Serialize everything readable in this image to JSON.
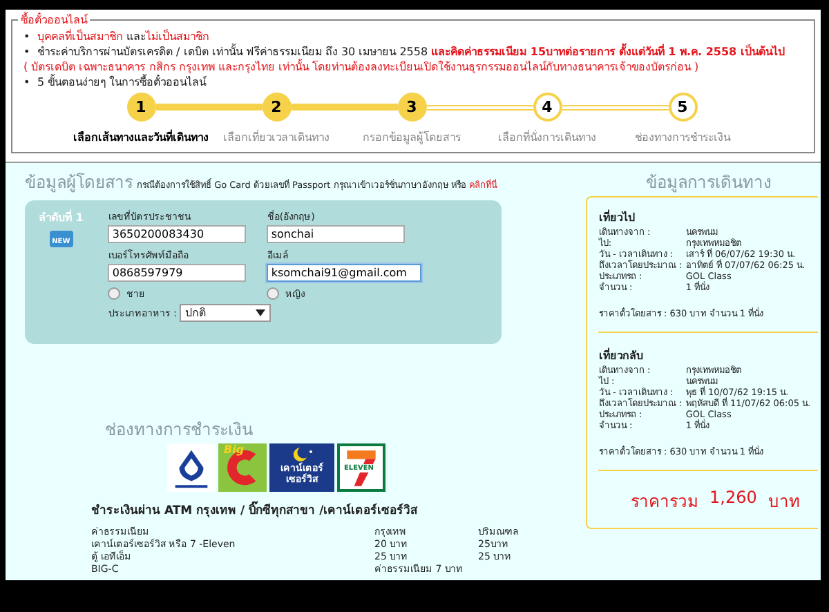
{
  "notice": {
    "legend": "ซื้อตั๋วออนไลน์",
    "bullets": [
      {
        "marker": "•",
        "parts": [
          {
            "text": "บุคคลที่เป็นสมาชิก",
            "emphasis": true
          },
          {
            "text": " และ",
            "emphasis": false
          },
          {
            "text": "ไม่เป็นสมาชิก",
            "emphasis": true
          }
        ]
      },
      {
        "marker": "•",
        "parts": [
          {
            "text": "ชำระค่าบริการผ่านบัตรเครดิต / เดบิต เท่านั้น ฟรีค่าธรรมเนียม ถึง 30 เมษายน 2558 ",
            "emphasis": false
          },
          {
            "text": "**และคิดค่าธรรมเนียม 15บาทต่อรายการ ตั้งแต่วันที่ 1 พ.ค. 2558 เป็นต้นไป**",
            "emphasis": true
          }
        ],
        "note": "( บัตรเดบิต เฉพาะธนาคาร กสิกร กรุงเทพ และกรุงไทย เท่านั้น โดยท่านต้องลงทะเบียนเปิดใช้งานธุรกรรมออนไลน์กับทางธนาคารเจ้าของบัตรก่อน )"
      },
      {
        "marker": "•",
        "parts": [
          {
            "text": "5 ขั้นตอนง่ายๆ ในการซื้อตั๋วออนไลน์",
            "emphasis": false
          }
        ]
      }
    ]
  },
  "steps": [
    {
      "number": "1",
      "label": "เลือกเส้นทางและวันที่เดินทาง",
      "done": true,
      "selected": true
    },
    {
      "number": "2",
      "label": "เลือกเที่ยวเวลาเดินทาง",
      "done": true,
      "selected": false
    },
    {
      "number": "3",
      "label": "กรอกข้อมูลผู้โดยสาร",
      "done": true,
      "selected": false
    },
    {
      "number": "4",
      "label": "เลือกที่นั่งการเดินทาง",
      "done": false,
      "selected": false
    },
    {
      "number": "5",
      "label": "ช่องทางการชำระเงิน",
      "done": false,
      "selected": false
    }
  ],
  "passenger": {
    "title": "ข้อมูลผู้โดยสาร",
    "note": "กรณีต้องการใช้สิทธิ์ Go Card ด้วยเลขที่ Passport กรุณาเข้าเวอร์ชั่นภาษาอังกฤษ หรือ ",
    "link": "คลิกที่นี่",
    "seat_label": "ลำดับที่ 1",
    "badge": "NEW",
    "fields": [
      {
        "label": "เลขที่บัตรประชาชน",
        "value": "3650200083430",
        "focused": false
      },
      {
        "label": "ชื่อ(อังกฤษ)",
        "value": "sonchai",
        "focused": false
      },
      {
        "label": "เบอร์โทรศัพท์มือถือ",
        "value": "0868597979",
        "focused": false
      },
      {
        "label": "อีเมล์",
        "value": "ksomchai91@gmail.com",
        "focused": true
      }
    ],
    "genders": [
      {
        "label": "ชาย",
        "selected": false
      },
      {
        "label": "หญิง",
        "selected": false
      }
    ],
    "meal_label": "ประเภทอาหาร :",
    "meal_value": "ปกติ"
  },
  "trip": {
    "title": "ข้อมูลการเดินทาง",
    "legs": [
      {
        "heading": "เที่ยวไป",
        "rows": [
          [
            "เดินทางจาก :",
            "นครพนม"
          ],
          [
            "ไป:",
            "กรุงเทพหมอชิต"
          ],
          [
            "วัน - เวลาเดินทาง :",
            "เสาร์ ที่ 06/07/62 19:30 น."
          ],
          [
            "ถึงเวลาโดยประมาณ :",
            "อาทิตย์ ที่ 07/07/62 06:25 น."
          ],
          [
            "ประเภทรถ :",
            "GOL Class"
          ],
          [
            "จำนวน :",
            "1   ที่นั่ง"
          ]
        ],
        "price": "ราคาตั๋วโดยสาร : 630  บาท   จำนวน 1 ที่นั่ง"
      },
      {
        "heading": "เที่ยวกลับ",
        "rows": [
          [
            "เดินทางจาก :",
            "กรุงเทพหมอชิต"
          ],
          [
            "ไป :",
            "นครพนม"
          ],
          [
            "วัน - เวลาเดินทาง :",
            "พุธ ที่ 10/07/62 19:15 น."
          ],
          [
            "ถึงเวลาโดยประมาณ :",
            "พฤหัสบดี ที่ 11/07/62 06:05 น."
          ],
          [
            "ประเภทรถ :",
            "GOL Class"
          ],
          [
            "จำนวน :",
            "1   ที่นั่ง"
          ]
        ],
        "price": "ราคาตั๋วโดยสาร : 630  บาท   จำนวน 1 ที่นั่ง"
      }
    ],
    "total_label": "ราคารวม",
    "total": "1,260",
    "currency": "บาท"
  },
  "payment": {
    "title": "ช่องทางการชำระเงิน",
    "logos": [
      {
        "kind": "bank"
      },
      {
        "kind": "bigc",
        "text": "Big"
      },
      {
        "kind": "counter",
        "text": "เคาน์เตอร์ เซอร์วิส"
      },
      {
        "kind": "seven",
        "text": "ELEVEN"
      }
    ],
    "heading": "ชำระเงินผ่าน ATM กรุงเทพ / บิ๊กซีทุกสาขา /เคาน์เตอร์เซอร์วิส",
    "rows": [
      [
        "ค่าธรรมเนียม",
        "กรุงเทพ",
        "ปริมณฑล"
      ],
      [
        "เคาน์เตอร์เซอร์วิส หรือ 7 -Eleven",
        "20 บาท",
        "25บาท"
      ],
      [
        "ตู้ เอทีเอ็ม",
        "25 บาท",
        "25 บาท"
      ],
      [
        "BIG-C",
        "ค่าธรรมเนียม 7 บาท"
      ]
    ]
  }
}
